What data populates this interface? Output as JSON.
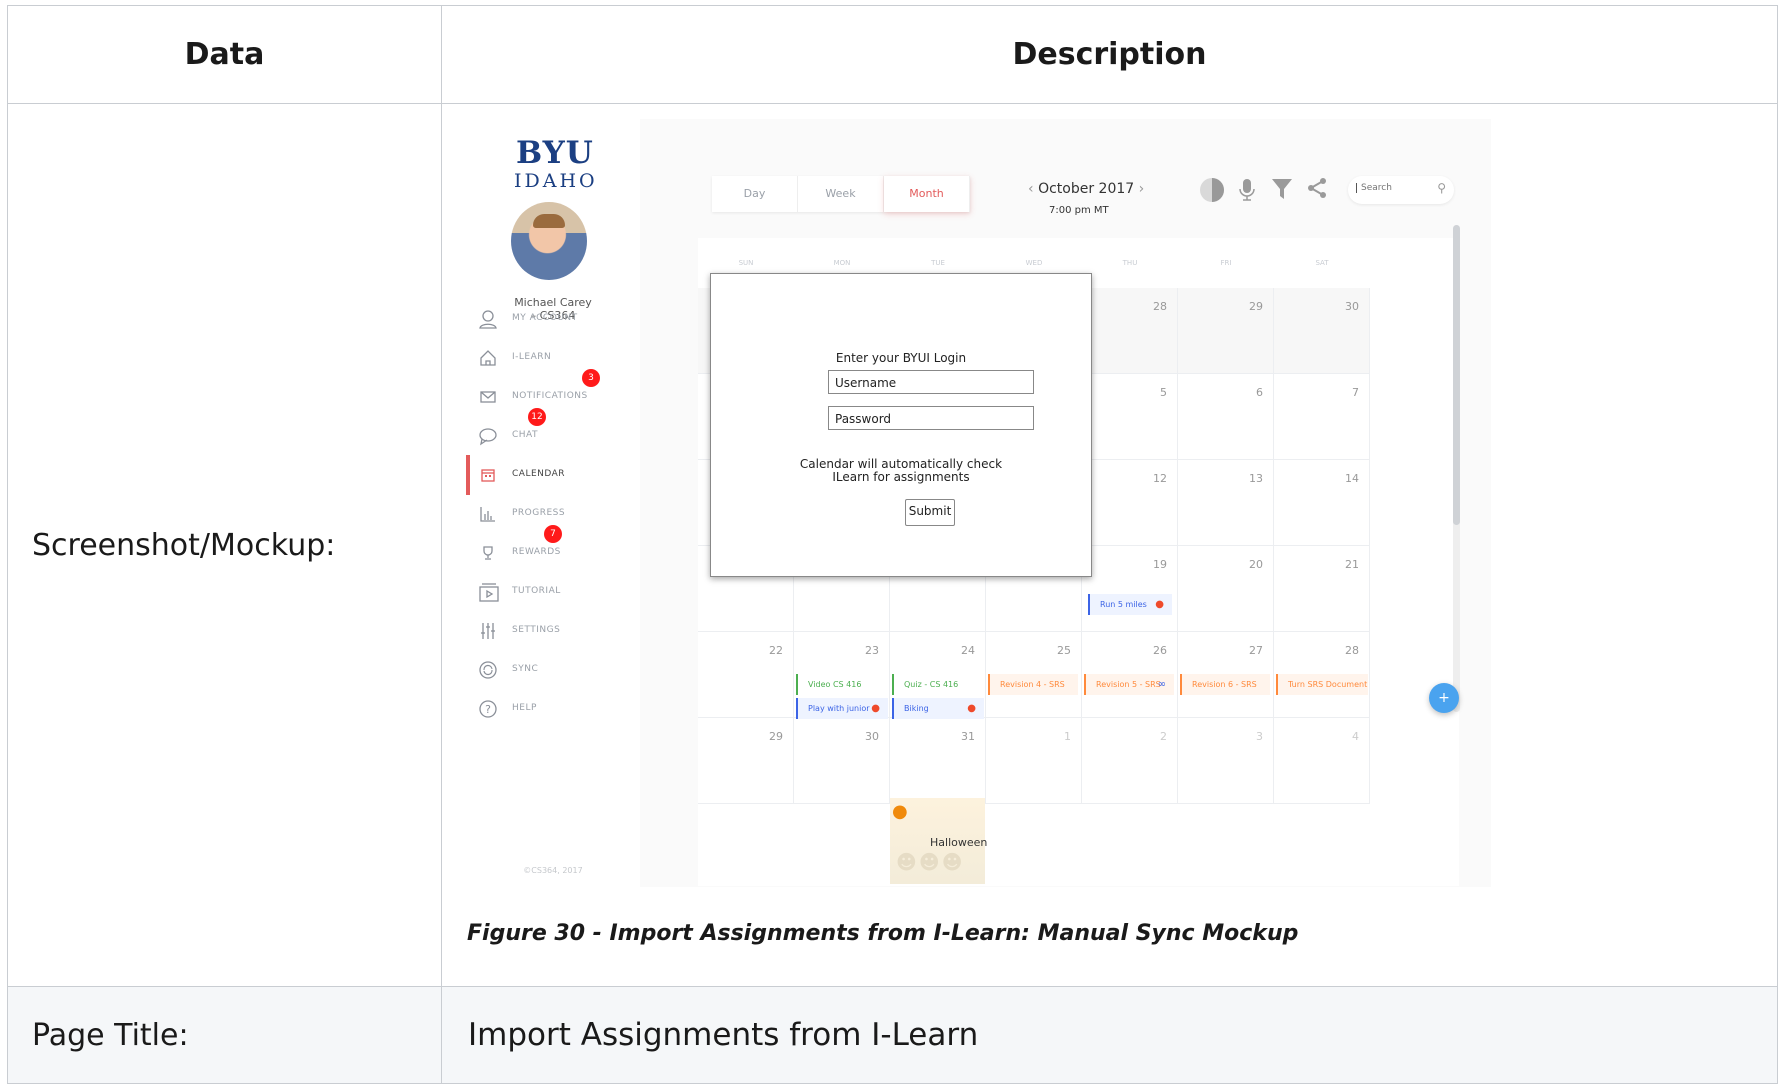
{
  "table": {
    "header_data": "Data",
    "header_description": "Description",
    "row1_label": "Screenshot/Mockup:",
    "row2_label": "Page Title:",
    "row2_value": "Import Assignments from I-Learn",
    "caption": "Figure 30 - Import Assignments from I-Learn: Manual Sync Mockup"
  },
  "mockup": {
    "logo_line1": "BYU",
    "logo_line2": "IDAHO",
    "user_name_line1": "Michael Carey",
    "user_name_line2": "– CS364",
    "nav": [
      {
        "label": "MY ACCOUNT",
        "icon": "user-icon"
      },
      {
        "label": "I-LEARN",
        "icon": "home-icon"
      },
      {
        "label": "NOTIFICATIONS",
        "icon": "mail-icon",
        "badge": "3"
      },
      {
        "label": "CHAT",
        "icon": "chat-icon",
        "badge": "12"
      },
      {
        "label": "CALENDAR",
        "icon": "calendar-icon",
        "active": true
      },
      {
        "label": "PROGRESS",
        "icon": "bar-chart-icon"
      },
      {
        "label": "REWARDS",
        "icon": "trophy-icon",
        "badge": "7"
      },
      {
        "label": "TUTORIAL",
        "icon": "play-icon"
      },
      {
        "label": "SETTINGS",
        "icon": "sliders-icon"
      },
      {
        "label": "SYNC",
        "icon": "sync-icon"
      },
      {
        "label": "HELP",
        "icon": "help-icon"
      }
    ],
    "copyright": "©CS364, 2017",
    "view_tabs": [
      "Day",
      "Week",
      "Month"
    ],
    "active_view": "Month",
    "month_label": "October 2017",
    "time_label": "7:00 pm MT",
    "search_placeholder": "Search",
    "day_headers": [
      "SUN",
      "MON",
      "TUE",
      "WED",
      "THU",
      "FRI",
      "SAT"
    ],
    "weeks": [
      [
        "",
        "",
        "",
        "",
        "28",
        "29",
        "30"
      ],
      [
        "",
        "",
        "",
        "",
        "5",
        "6",
        "7"
      ],
      [
        "",
        "",
        "",
        "",
        "12",
        "13",
        "14"
      ],
      [
        "",
        "",
        "",
        "",
        "19",
        "20",
        "21"
      ],
      [
        "22",
        "23",
        "24",
        "25",
        "26",
        "27",
        "28"
      ],
      [
        "29",
        "30",
        "31",
        "1",
        "2",
        "3",
        "4"
      ]
    ],
    "events": {
      "run": "Run 5 miles",
      "video": "Video CS 416",
      "quiz": "Quiz - CS 416",
      "rev4": "Revision 4 - SRS",
      "rev5": "Revision 5 - SRS",
      "rev6": "Revision 6 - SRS",
      "turn": "Turn SRS Document",
      "play": "Play with junior",
      "biking": "Biking"
    },
    "halloween": "Halloween",
    "modal": {
      "title": "Enter your BYUI Login",
      "username_placeholder": "Username",
      "password_placeholder": "Password",
      "note_line1": "Calendar will automatically check",
      "note_line2": "ILearn for assignments",
      "submit": "Submit"
    },
    "fab": "+",
    "colors": {
      "accent": "#e35b5b",
      "brand": "#1b3f82",
      "badge": "#ff1a1a",
      "fab": "#4aa3ef"
    }
  }
}
